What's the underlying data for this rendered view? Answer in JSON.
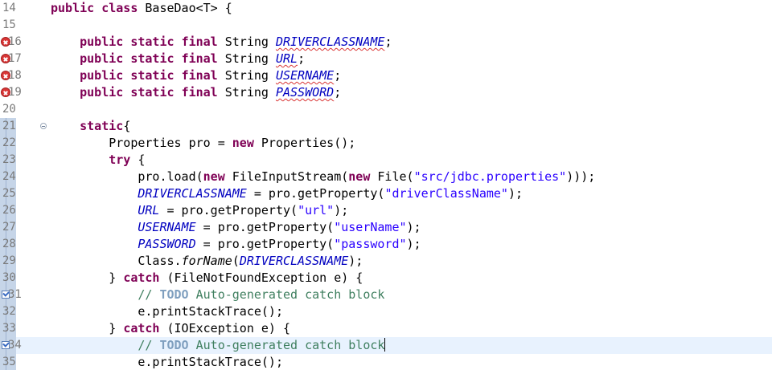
{
  "editor": {
    "lines": [
      {
        "num": "14",
        "marker": "none",
        "changed": false,
        "current": false,
        "tokens": [
          {
            "t": "kw",
            "v": "public"
          },
          {
            "t": "pl",
            "v": " "
          },
          {
            "t": "kw",
            "v": "class"
          },
          {
            "t": "pl",
            "v": " BaseDao<T> {"
          }
        ]
      },
      {
        "num": "15",
        "marker": "none",
        "changed": false,
        "current": false,
        "tokens": []
      },
      {
        "num": "16",
        "marker": "error",
        "changed": false,
        "current": false,
        "tokens": [
          {
            "t": "pl",
            "v": "    "
          },
          {
            "t": "kw",
            "v": "public"
          },
          {
            "t": "pl",
            "v": " "
          },
          {
            "t": "kw",
            "v": "static"
          },
          {
            "t": "pl",
            "v": " "
          },
          {
            "t": "kw",
            "v": "final"
          },
          {
            "t": "pl",
            "v": " String "
          },
          {
            "t": "fld err",
            "v": "DRIVERCLASSNAME"
          },
          {
            "t": "pl",
            "v": ";"
          }
        ]
      },
      {
        "num": "17",
        "marker": "error",
        "changed": false,
        "current": false,
        "tokens": [
          {
            "t": "pl",
            "v": "    "
          },
          {
            "t": "kw",
            "v": "public"
          },
          {
            "t": "pl",
            "v": " "
          },
          {
            "t": "kw",
            "v": "static"
          },
          {
            "t": "pl",
            "v": " "
          },
          {
            "t": "kw",
            "v": "final"
          },
          {
            "t": "pl",
            "v": " String "
          },
          {
            "t": "fld err",
            "v": "URL"
          },
          {
            "t": "pl",
            "v": ";"
          }
        ]
      },
      {
        "num": "18",
        "marker": "error",
        "changed": false,
        "current": false,
        "tokens": [
          {
            "t": "pl",
            "v": "    "
          },
          {
            "t": "kw",
            "v": "public"
          },
          {
            "t": "pl",
            "v": " "
          },
          {
            "t": "kw",
            "v": "static"
          },
          {
            "t": "pl",
            "v": " "
          },
          {
            "t": "kw",
            "v": "final"
          },
          {
            "t": "pl",
            "v": " String "
          },
          {
            "t": "fld err",
            "v": "USERNAME"
          },
          {
            "t": "pl",
            "v": ";"
          }
        ]
      },
      {
        "num": "19",
        "marker": "error",
        "changed": false,
        "current": false,
        "tokens": [
          {
            "t": "pl",
            "v": "    "
          },
          {
            "t": "kw",
            "v": "public"
          },
          {
            "t": "pl",
            "v": " "
          },
          {
            "t": "kw",
            "v": "static"
          },
          {
            "t": "pl",
            "v": " "
          },
          {
            "t": "kw",
            "v": "final"
          },
          {
            "t": "pl",
            "v": " String "
          },
          {
            "t": "fld err",
            "v": "PASSWORD"
          },
          {
            "t": "pl",
            "v": ";"
          }
        ]
      },
      {
        "num": "20",
        "marker": "none",
        "changed": false,
        "current": false,
        "tokens": []
      },
      {
        "num": "21",
        "marker": "fold",
        "changed": true,
        "current": false,
        "tokens": [
          {
            "t": "pl",
            "v": "    "
          },
          {
            "t": "kw",
            "v": "static"
          },
          {
            "t": "pl",
            "v": "{"
          }
        ]
      },
      {
        "num": "22",
        "marker": "none",
        "changed": true,
        "current": false,
        "tokens": [
          {
            "t": "pl",
            "v": "        Properties pro = "
          },
          {
            "t": "kw",
            "v": "new"
          },
          {
            "t": "pl",
            "v": " Properties();"
          }
        ]
      },
      {
        "num": "23",
        "marker": "none",
        "changed": true,
        "current": false,
        "tokens": [
          {
            "t": "pl",
            "v": "        "
          },
          {
            "t": "kw",
            "v": "try"
          },
          {
            "t": "pl",
            "v": " {"
          }
        ]
      },
      {
        "num": "24",
        "marker": "none",
        "changed": true,
        "current": false,
        "tokens": [
          {
            "t": "pl",
            "v": "            pro.load("
          },
          {
            "t": "kw",
            "v": "new"
          },
          {
            "t": "pl",
            "v": " FileInputStream("
          },
          {
            "t": "kw",
            "v": "new"
          },
          {
            "t": "pl",
            "v": " File("
          },
          {
            "t": "str",
            "v": "\"src/jdbc.properties\""
          },
          {
            "t": "pl",
            "v": ")));"
          }
        ]
      },
      {
        "num": "25",
        "marker": "none",
        "changed": true,
        "current": false,
        "tokens": [
          {
            "t": "pl",
            "v": "            "
          },
          {
            "t": "fld",
            "v": "DRIVERCLASSNAME"
          },
          {
            "t": "pl",
            "v": " = pro.getProperty("
          },
          {
            "t": "str",
            "v": "\"driverClassName\""
          },
          {
            "t": "pl",
            "v": ");"
          }
        ]
      },
      {
        "num": "26",
        "marker": "none",
        "changed": true,
        "current": false,
        "tokens": [
          {
            "t": "pl",
            "v": "            "
          },
          {
            "t": "fld",
            "v": "URL"
          },
          {
            "t": "pl",
            "v": " = pro.getProperty("
          },
          {
            "t": "str",
            "v": "\"url\""
          },
          {
            "t": "pl",
            "v": ");"
          }
        ]
      },
      {
        "num": "27",
        "marker": "none",
        "changed": true,
        "current": false,
        "tokens": [
          {
            "t": "pl",
            "v": "            "
          },
          {
            "t": "fld",
            "v": "USERNAME"
          },
          {
            "t": "pl",
            "v": " = pro.getProperty("
          },
          {
            "t": "str",
            "v": "\"userName\""
          },
          {
            "t": "pl",
            "v": ");"
          }
        ]
      },
      {
        "num": "28",
        "marker": "none",
        "changed": true,
        "current": false,
        "tokens": [
          {
            "t": "pl",
            "v": "            "
          },
          {
            "t": "fld",
            "v": "PASSWORD"
          },
          {
            "t": "pl",
            "v": " = pro.getProperty("
          },
          {
            "t": "str",
            "v": "\"password\""
          },
          {
            "t": "pl",
            "v": ");"
          }
        ]
      },
      {
        "num": "29",
        "marker": "none",
        "changed": true,
        "current": false,
        "tokens": [
          {
            "t": "pl",
            "v": "            Class."
          },
          {
            "t": "mth",
            "v": "forName"
          },
          {
            "t": "pl",
            "v": "("
          },
          {
            "t": "fld",
            "v": "DRIVERCLASSNAME"
          },
          {
            "t": "pl",
            "v": ");"
          }
        ]
      },
      {
        "num": "30",
        "marker": "none",
        "changed": true,
        "current": false,
        "tokens": [
          {
            "t": "pl",
            "v": "        } "
          },
          {
            "t": "kw",
            "v": "catch"
          },
          {
            "t": "pl",
            "v": " (FileNotFoundException e) {"
          }
        ]
      },
      {
        "num": "31",
        "marker": "task",
        "changed": true,
        "current": false,
        "tokens": [
          {
            "t": "pl",
            "v": "            "
          },
          {
            "t": "cmt",
            "v": "// "
          },
          {
            "t": "todo",
            "v": "TODO"
          },
          {
            "t": "cmt",
            "v": " Auto-generated catch block"
          }
        ]
      },
      {
        "num": "32",
        "marker": "none",
        "changed": true,
        "current": false,
        "tokens": [
          {
            "t": "pl",
            "v": "            e.printStackTrace();"
          }
        ]
      },
      {
        "num": "33",
        "marker": "none",
        "changed": true,
        "current": false,
        "tokens": [
          {
            "t": "pl",
            "v": "        } "
          },
          {
            "t": "kw",
            "v": "catch"
          },
          {
            "t": "pl",
            "v": " (IOException e) {"
          }
        ]
      },
      {
        "num": "34",
        "marker": "task",
        "changed": true,
        "current": true,
        "tokens": [
          {
            "t": "pl",
            "v": "            "
          },
          {
            "t": "cmt",
            "v": "// "
          },
          {
            "t": "todo",
            "v": "TODO"
          },
          {
            "t": "cmt",
            "v": " Auto-generated catch block"
          },
          {
            "t": "caret",
            "v": ""
          }
        ]
      },
      {
        "num": "35",
        "marker": "none",
        "changed": true,
        "current": false,
        "tokens": [
          {
            "t": "pl",
            "v": "            e.printStackTrace();"
          }
        ]
      }
    ]
  }
}
